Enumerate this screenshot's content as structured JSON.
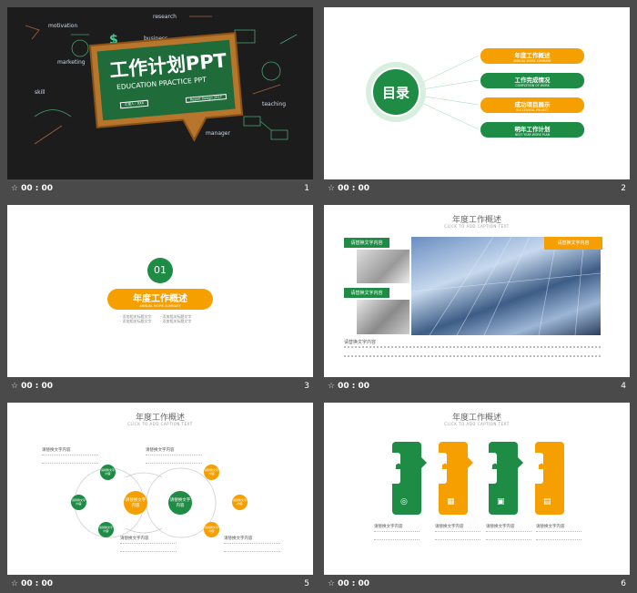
{
  "colors": {
    "green": "#1e8c45",
    "orange": "#f5a000",
    "background": "#4a4a4a",
    "chalkboard": "#1c1c1c"
  },
  "slides": [
    {
      "number": "1",
      "time": "00 : 00",
      "sign_title": "工作计划PPT",
      "sign_sub": "EDUCATION PRACTICE PPT",
      "sign_left_tag": "汇报人：XXX",
      "sign_right_tag": "Report Design 2017",
      "chalk_words": [
        "motivation",
        "research",
        "business",
        "marketing",
        "teaching",
        "manager",
        "skill",
        "$",
        "$"
      ]
    },
    {
      "number": "2",
      "time": "00 : 00",
      "circle_text": "目录",
      "items": [
        {
          "title": "年度工作概述",
          "sub": "ANNUAL WORK SUMMARY",
          "color": "orange"
        },
        {
          "title": "工作完成情况",
          "sub": "COMPLETION OF WORK",
          "color": "green"
        },
        {
          "title": "成功项目展示",
          "sub": "SUCCESSFUL PROJECT",
          "color": "orange"
        },
        {
          "title": "明年工作计划",
          "sub": "NEXT YEAR WORK PLAN",
          "color": "green"
        }
      ]
    },
    {
      "number": "3",
      "time": "00 : 00",
      "badge": "01",
      "title": "年度工作概述",
      "sub": "ANNUAL WORK SUMMARY",
      "bullets": [
        "添加相关标题文字",
        "添加相关标题文字",
        "添加相关标题文字",
        "添加相关标题文字"
      ]
    },
    {
      "number": "4",
      "time": "00 : 00",
      "title": "年度工作概述",
      "sub": "CLICK TO ADD CAPTION TEXT",
      "tag1": "请替换文字内容",
      "tag2": "请替换文字内容",
      "tag3": "请替换文字内容",
      "caption": "请替换文字内容"
    },
    {
      "number": "5",
      "time": "00 : 00",
      "title": "年度工作概述",
      "sub": "CLICK TO ADD CAPTION TEXT",
      "center_left": "请替换文字内容",
      "center_right": "请替换文字内容",
      "node": "请替换文字内容",
      "label": "请替换文字内容"
    },
    {
      "number": "6",
      "time": "00 : 00",
      "title": "年度工作概述",
      "sub": "CLICK TO ADD CAPTION TEXT",
      "label": "请替换文字内容"
    }
  ]
}
